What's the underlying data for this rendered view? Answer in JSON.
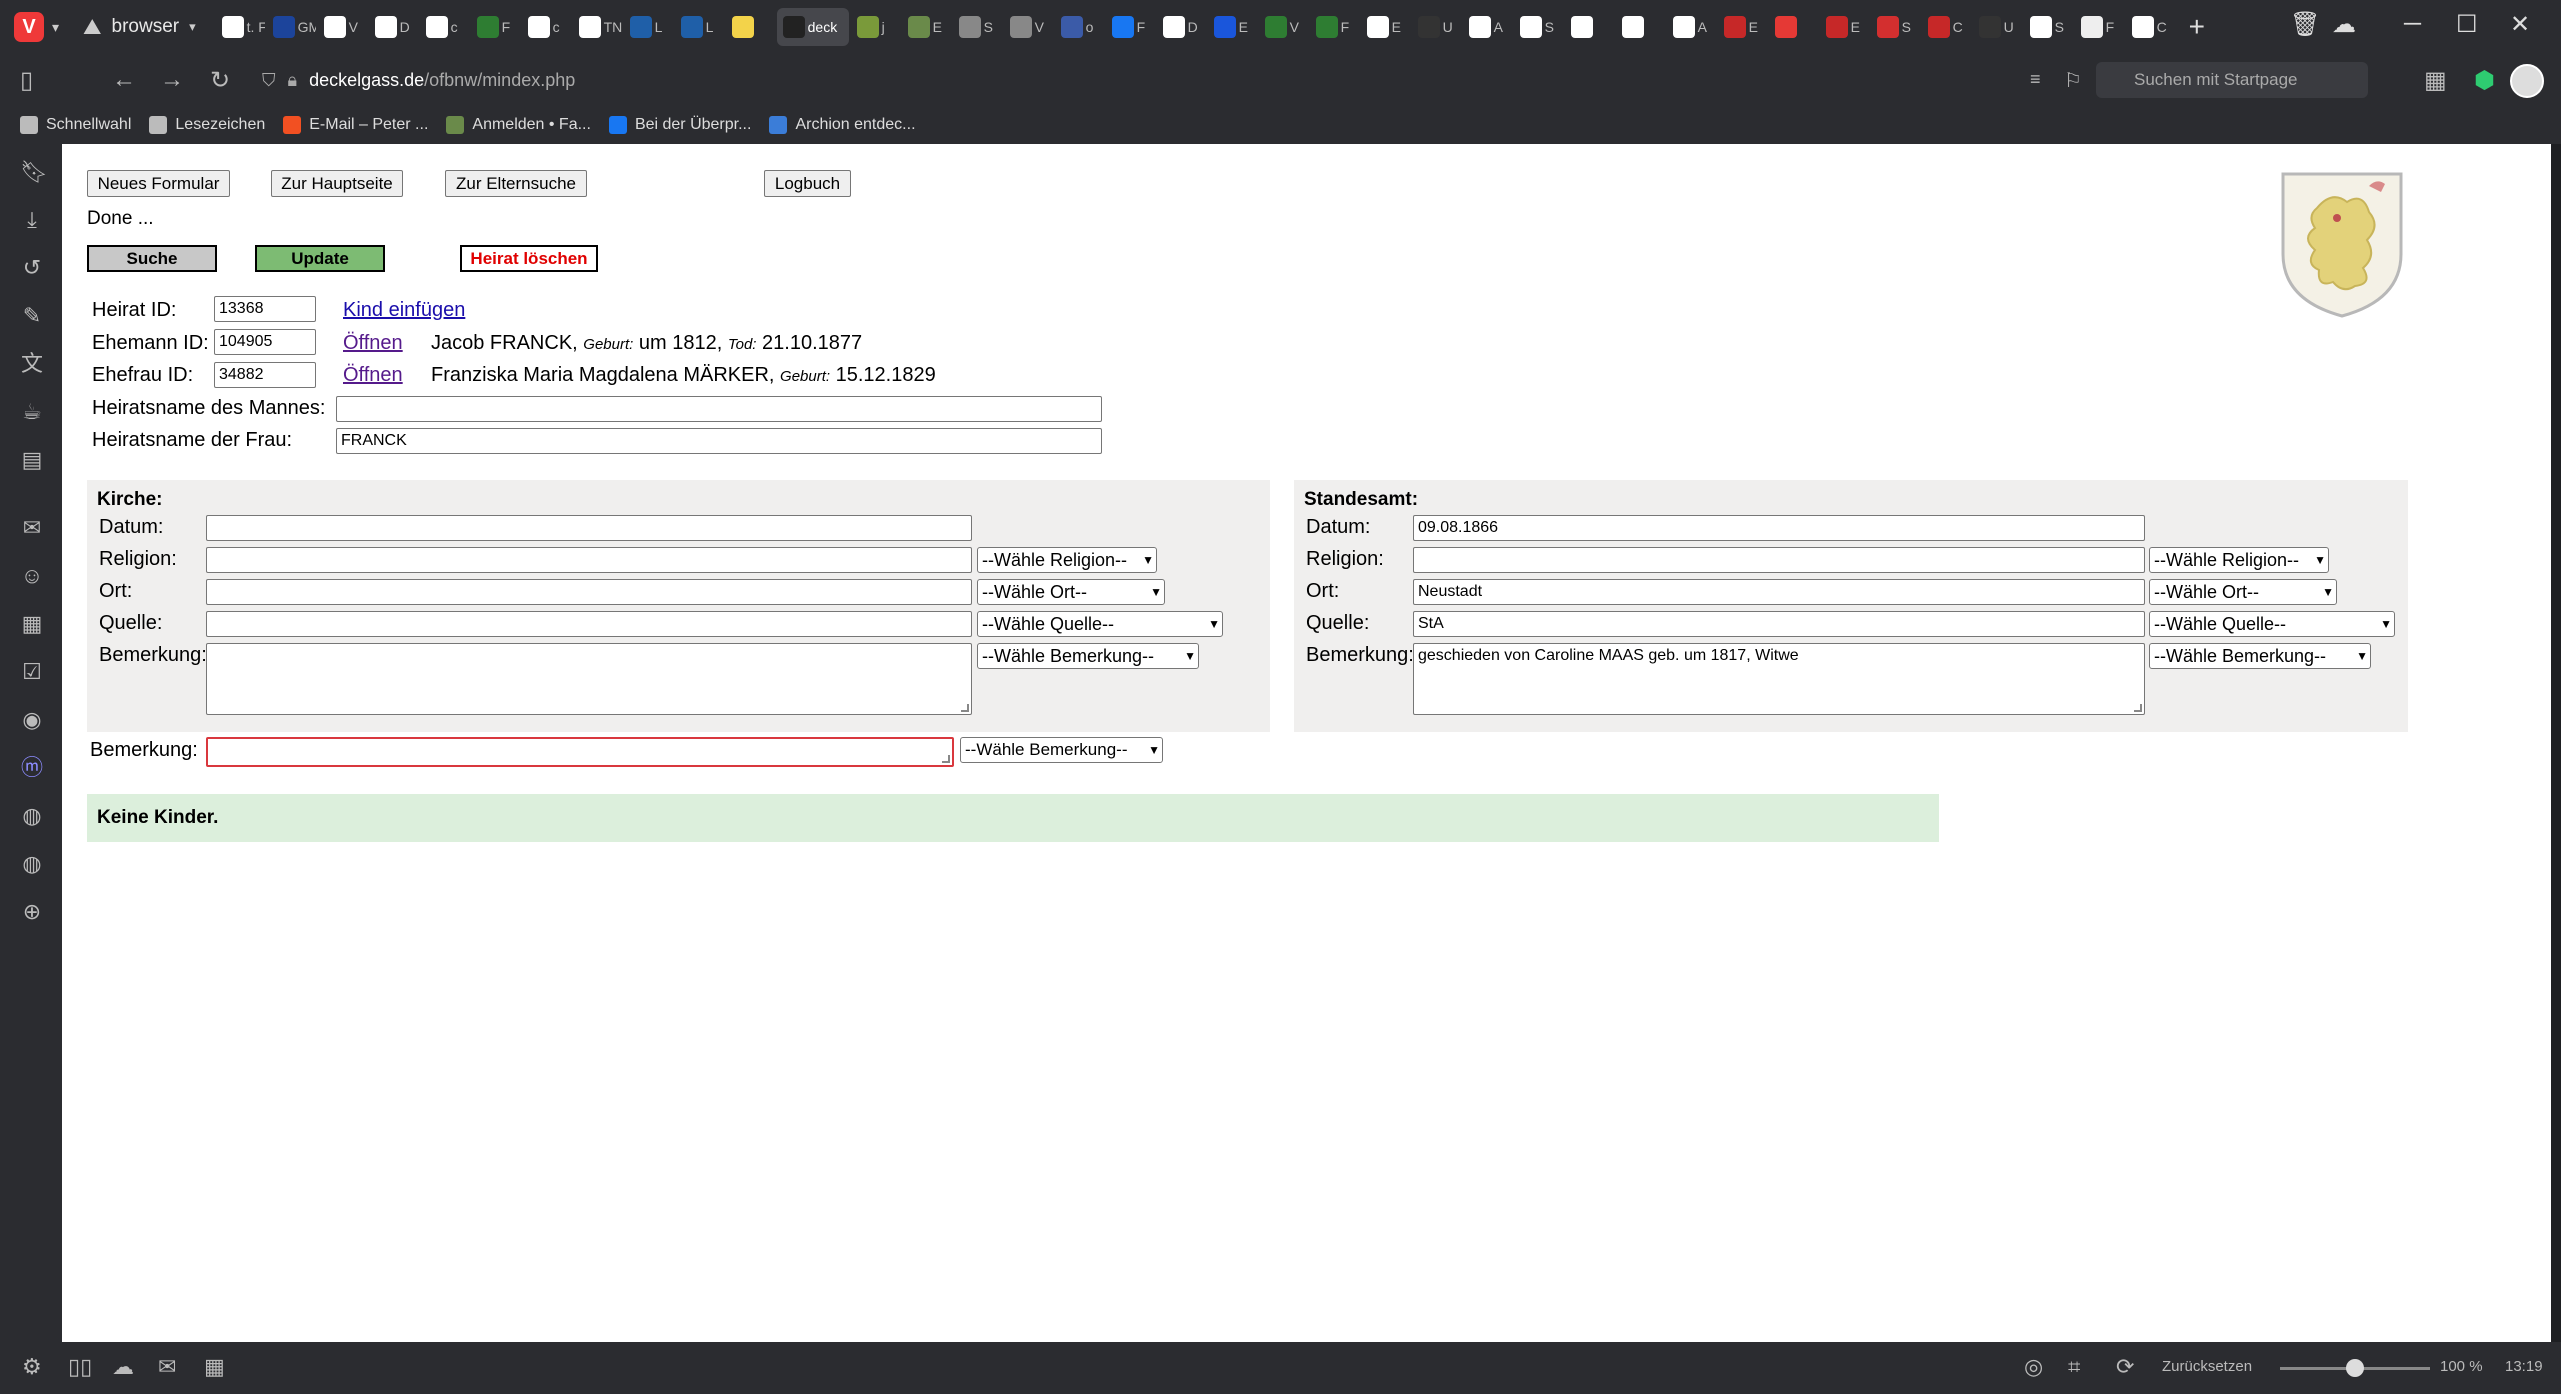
{
  "tabbar": {
    "workspace_label": "browser",
    "tabs": [
      {
        "title": "t. F",
        "color": "#ffffff"
      },
      {
        "title": "GMX C",
        "color": "#1c449b"
      },
      {
        "title": "V",
        "color": "#ffffff"
      },
      {
        "title": "D",
        "color": "#ffffff"
      },
      {
        "title": "c",
        "color": "#ffffff"
      },
      {
        "title": "F",
        "color": "#2e7d32"
      },
      {
        "title": "c",
        "color": "#ffffff"
      },
      {
        "title": "TNG F",
        "color": "#ffffff"
      },
      {
        "title": "L",
        "color": "#1f5fa8"
      },
      {
        "title": "L",
        "color": "#1f5fa8"
      },
      {
        "title": "",
        "color": "#f3d34a"
      },
      {
        "title": "deck",
        "color": "#222222"
      },
      {
        "title": "j",
        "color": "#7a9a3a"
      },
      {
        "title": "E",
        "color": "#6a8a4a"
      },
      {
        "title": "S",
        "color": "#888888"
      },
      {
        "title": "V",
        "color": "#888888"
      },
      {
        "title": "o",
        "color": "#3b5ba8"
      },
      {
        "title": "F",
        "color": "#1877f2"
      },
      {
        "title": "D",
        "color": "#ffffff"
      },
      {
        "title": "E",
        "color": "#1a56db"
      },
      {
        "title": "V",
        "color": "#2e7d32"
      },
      {
        "title": "F",
        "color": "#2e7d32"
      },
      {
        "title": "E",
        "color": "#ffffff"
      },
      {
        "title": "U",
        "color": "#333333"
      },
      {
        "title": "A",
        "color": "#ffffff"
      },
      {
        "title": "S",
        "color": "#ffffff"
      },
      {
        "title": "",
        "color": "#ffffff"
      },
      {
        "title": "",
        "color": "#ffffff"
      },
      {
        "title": "A",
        "color": "#ffffff"
      },
      {
        "title": "E",
        "color": "#c62828"
      },
      {
        "title": "",
        "color": "#e53935"
      },
      {
        "title": "E",
        "color": "#c62828"
      },
      {
        "title": "S",
        "color": "#d32f2f"
      },
      {
        "title": "C",
        "color": "#c62828"
      },
      {
        "title": "U",
        "color": "#333333"
      },
      {
        "title": "S",
        "color": "#ffffff"
      },
      {
        "title": "F",
        "color": "#eeeeee"
      },
      {
        "title": "C",
        "color": "#ffffff"
      }
    ],
    "active_tab_index": 11
  },
  "addressbar": {
    "url_host": "deckelgass.de",
    "url_path": "/ofbnw/mindex.php",
    "search_placeholder": "Suchen mit Startpage"
  },
  "bookmarks": [
    {
      "label": "Schnellwahl",
      "icon": "speed-dial-icon",
      "color": "#bbbbbb"
    },
    {
      "label": "Lesezeichen",
      "icon": "folder-icon",
      "color": "#bbbbbb"
    },
    {
      "label": "E-Mail – Peter ...",
      "icon": "windows-icon",
      "color": "#f25022"
    },
    {
      "label": "Anmelden • Fa...",
      "icon": "tree-icon",
      "color": "#6a8a4a"
    },
    {
      "label": "Bei der Überpr...",
      "icon": "facebook-icon",
      "color": "#1877f2"
    },
    {
      "label": "Archion entdec...",
      "icon": "book-icon",
      "color": "#3b7dd8"
    }
  ],
  "page": {
    "buttons": {
      "new_form": "Neues Formular",
      "main_page": "Zur Hauptseite",
      "parent_search": "Zur Elternsuche",
      "logbook": "Logbuch",
      "search": "Suche",
      "update": "Update",
      "delete_marriage": "Heirat löschen"
    },
    "status": "Done ...",
    "marriage": {
      "id_label": "Heirat ID:",
      "id_value": "13368",
      "insert_child": "Kind einfügen",
      "husband_label": "Ehemann ID:",
      "husband_id": "104905",
      "husband_open": "Öffnen",
      "husband_name": "Jacob FRANCK,",
      "husband_birth_label": "Geburt:",
      "husband_birth": "um 1812,",
      "husband_death_label": "Tod:",
      "husband_death": "21.10.1877",
      "wife_label": "Ehefrau ID:",
      "wife_id": "34882",
      "wife_open": "Öffnen",
      "wife_name": "Franziska Maria Magdalena MÄRKER,",
      "wife_birth_label": "Geburt:",
      "wife_birth": "15.12.1829",
      "husband_marriage_name_label": "Heiratsname des Mannes:",
      "husband_marriage_name": "",
      "wife_marriage_name_label": "Heiratsname der Frau:",
      "wife_marriage_name": "FRANCK"
    },
    "church": {
      "title": "Kirche:",
      "date_label": "Datum:",
      "date": "",
      "religion_label": "Religion:",
      "religion": "",
      "religion_select": "--Wähle Religion--",
      "place_label": "Ort:",
      "place": "",
      "place_select": "--Wähle Ort--",
      "source_label": "Quelle:",
      "source": "",
      "source_select": "--Wähle Quelle--",
      "remark_label": "Bemerkung:",
      "remark": "",
      "remark_select": "--Wähle Bemerkung--"
    },
    "civil": {
      "title": "Standesamt:",
      "date_label": "Datum:",
      "date": "09.08.1866",
      "religion_label": "Religion:",
      "religion": "",
      "religion_select": "--Wähle Religion--",
      "place_label": "Ort:",
      "place": "Neustadt",
      "place_select": "--Wähle Ort--",
      "source_label": "Quelle:",
      "source": "StA",
      "source_select": "--Wähle Quelle--",
      "remark_label": "Bemerkung:",
      "remark": "geschieden von Caroline MAAS geb. um 1817, Witwe",
      "remark_select": "--Wähle Bemerkung--"
    },
    "general_remark_label": "Bemerkung:",
    "general_remark": "",
    "general_remark_select": "--Wähle Bemerkung--",
    "no_children": "Keine Kinder."
  },
  "statusbar": {
    "reset_label": "Zurücksetzen",
    "zoom_percent": 100,
    "zoom_label": "100 %",
    "clock": "13:19"
  },
  "colors": {
    "update_button": "#7dbb73",
    "delete_button_text": "#e00000",
    "search_button": "#c8c8c8",
    "panel_bg": "#f0efee",
    "children_bar": "#dcefdc",
    "invalid_border": "#d9383e"
  }
}
